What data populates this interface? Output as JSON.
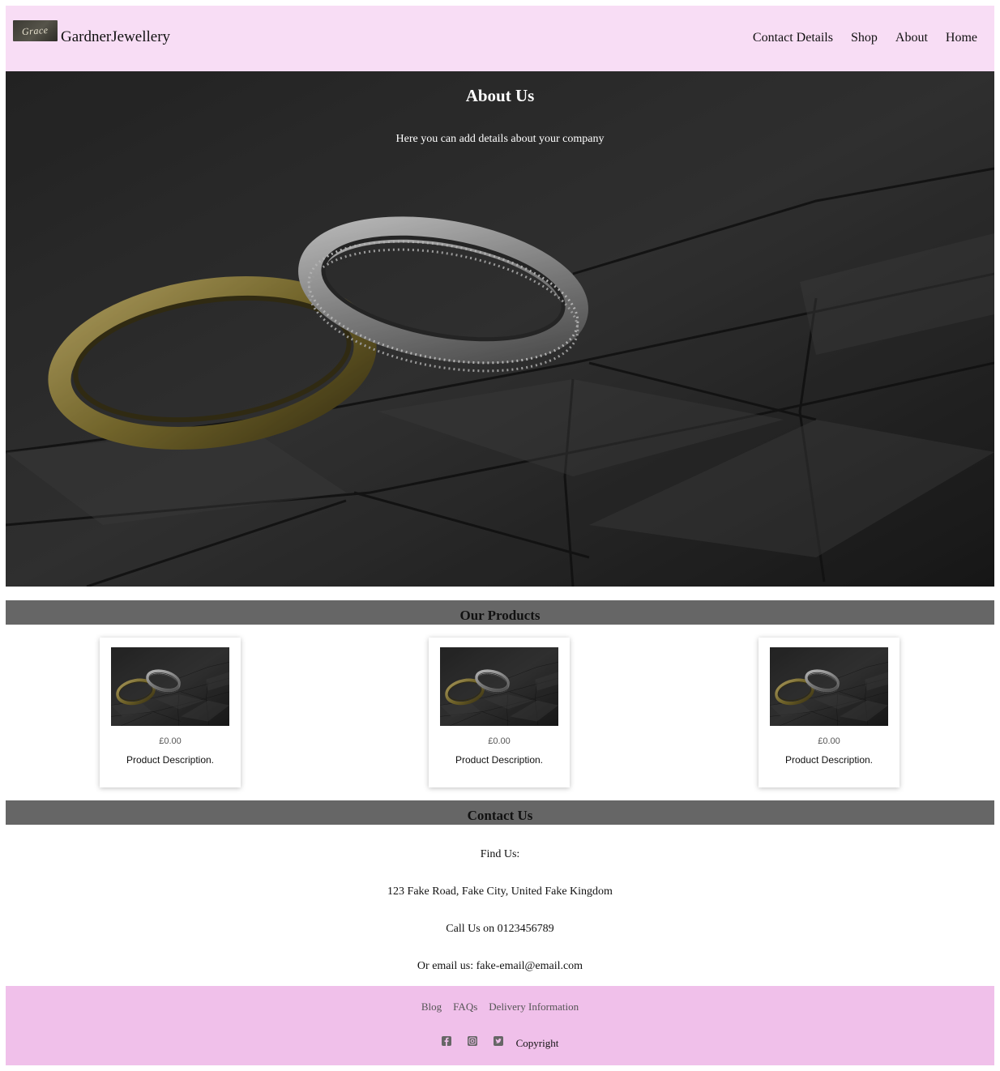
{
  "header": {
    "logo_text": "Grace",
    "brand": "GardnerJewellery",
    "nav": [
      "Contact Details",
      "Shop",
      "About",
      "Home"
    ]
  },
  "hero": {
    "title": "About Us",
    "subtitle": "Here you can add details about your company"
  },
  "products": {
    "heading": "Our Products",
    "items": [
      {
        "price": "£0.00",
        "description": "Product Description."
      },
      {
        "price": "£0.00",
        "description": "Product Description."
      },
      {
        "price": "£0.00",
        "description": "Product Description."
      }
    ]
  },
  "contact": {
    "heading": "Contact Us",
    "find_us": "Find Us:",
    "address": "123 Fake Road, Fake City, United Fake Kingdom",
    "phone": "Call Us on 0123456789",
    "email": "Or email us: fake-email@email.com"
  },
  "footer": {
    "links": [
      "Blog",
      "FAQs",
      "Delivery Information"
    ],
    "social_icons": [
      "facebook-icon",
      "instagram-icon",
      "twitter-icon"
    ],
    "copyright": "Copyright"
  },
  "colors": {
    "header_bg": "#f8ddf5",
    "section_bar": "#666666",
    "footer_bg": "#f0c0ea"
  }
}
